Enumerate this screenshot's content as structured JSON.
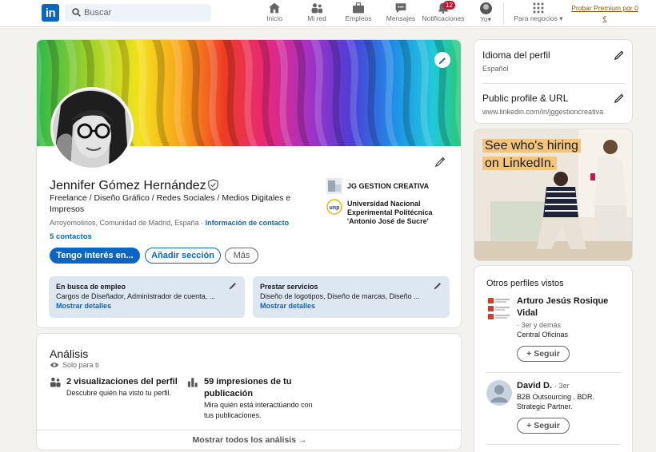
{
  "nav": {
    "logo": "in",
    "search_placeholder": "Buscar",
    "items": [
      {
        "label": "Inicio"
      },
      {
        "label": "Mi red"
      },
      {
        "label": "Empleos"
      },
      {
        "label": "Mensajes"
      },
      {
        "label": "Notificaciones",
        "badge": "12"
      },
      {
        "label": "Yo"
      },
      {
        "label": "Para negocios"
      }
    ],
    "premium": "Probar Premium por 0 €"
  },
  "profile": {
    "name": "Jennifer Gómez Hernández",
    "headline": "Freelance / Diseño Gráfico / Redes Sociales / Medios Digitales e Impresos",
    "location": "Arroyomolinos, Comunidad de Madrid, España",
    "separator": " · ",
    "contact_info": "Información de contacto",
    "connections": "5 contactos",
    "buttons": {
      "primary": "Tengo interés en...",
      "secondary": "Añadir sección",
      "more": "Más"
    },
    "organizations": [
      {
        "name": "JG GESTION CREATIVA"
      },
      {
        "name": "Universidad Nacional Experimental Politécnica 'Antonio José de Sucre'"
      }
    ],
    "open_to_work": {
      "title": "En busca de empleo",
      "desc": "Cargos de Diseñador, Administrador de cuenta, ...",
      "more": "Mostrar detalles"
    },
    "services": {
      "title": "Prestar servicios",
      "desc": "Diseño de logotipos, Diseño de marcas, Diseño ...",
      "more": "Mostrar detalles"
    }
  },
  "analytics": {
    "title": "Análisis",
    "private": "Solo para ti",
    "metrics": [
      {
        "title": "2 visualizaciones del perfil",
        "desc": "Descubre quién ha visto tu perfil."
      },
      {
        "title": "59 impresiones de tu publicación",
        "desc": "Mira quién está interactúando con tus publicaciones."
      }
    ],
    "footer": "Mostrar todos los análisis →"
  },
  "sidebar": {
    "language": {
      "title": "Idioma del perfil",
      "value": "Español"
    },
    "url": {
      "title": "Public profile & URL",
      "value": "www.linkedin.com/in/jggestioncreativa"
    },
    "ad": {
      "line1": "See who's hiring",
      "line2": "on LinkedIn."
    },
    "others": {
      "title": "Otros perfiles vistos",
      "people": [
        {
          "name": "Arturo Jesús Rosique Vidal",
          "degree": "· 3er y demás",
          "subtitle": "Central Oficinas",
          "follow": "Seguir"
        },
        {
          "name": "David D.",
          "degree": "· 3er",
          "subtitle": "B2B Outsourcing . BDR. Strategic Partner.",
          "follow": "Seguir"
        }
      ]
    }
  },
  "colors": {
    "brand": "#0a66c2",
    "badge": "#cb112d",
    "premium": "#915907"
  }
}
